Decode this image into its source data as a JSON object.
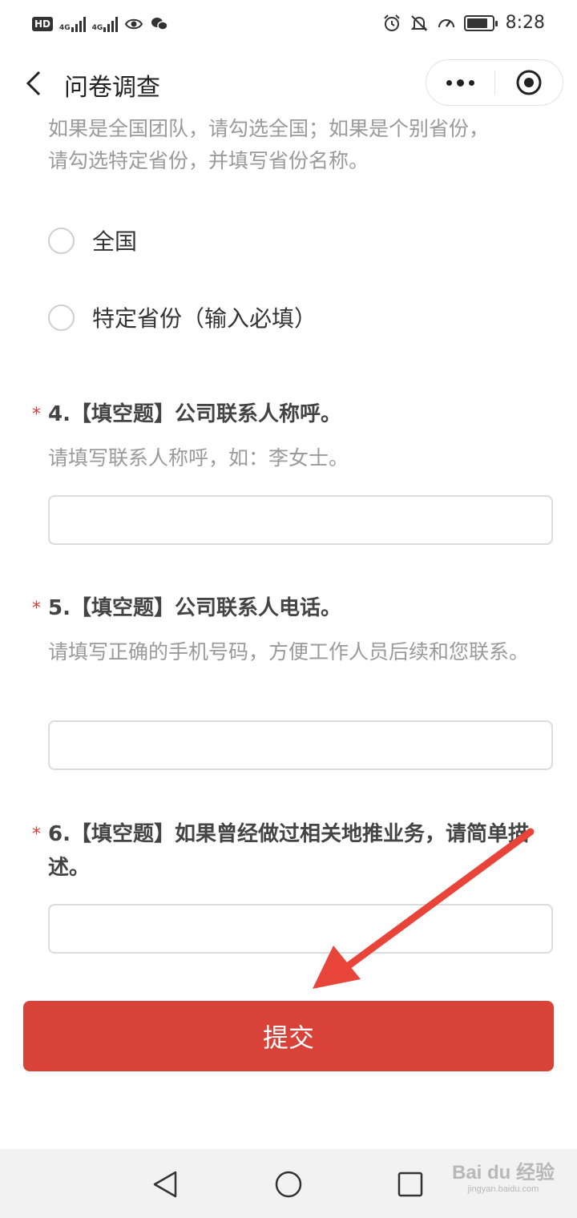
{
  "status_bar": {
    "hd": "HD",
    "network1": "4G",
    "network2": "4G",
    "time": "8:28",
    "battery_level": 0.85
  },
  "nav": {
    "title": "问卷调查"
  },
  "q3": {
    "hint_line1": "如果是全国团队，请勾选全国；如果是个别省份，",
    "hint_line2": "请勾选特定省份，并填写省份名称。",
    "options": [
      "全国",
      "特定省份（输入必填）"
    ]
  },
  "q4": {
    "required_mark": "*",
    "title": "4.【填空题】公司联系人称呼。",
    "hint": "请填写联系人称呼，如：李女士。",
    "value": ""
  },
  "q5": {
    "required_mark": "*",
    "title": "5.【填空题】公司联系人电话。",
    "hint": "请填写正确的手机号码，方便工作人员后续和您联系。",
    "value": ""
  },
  "q6": {
    "required_mark": "*",
    "title": "6.【填空题】如果曾经做过相关地推业务，请简单描述。",
    "value": ""
  },
  "submit": {
    "label": "提交"
  },
  "colors": {
    "accent": "#d84238",
    "arrow": "#e8443a",
    "hint_text": "#9a9a9a"
  },
  "watermark": {
    "main": "Bai du 经验",
    "sub": "jingyan.baidu.com"
  }
}
